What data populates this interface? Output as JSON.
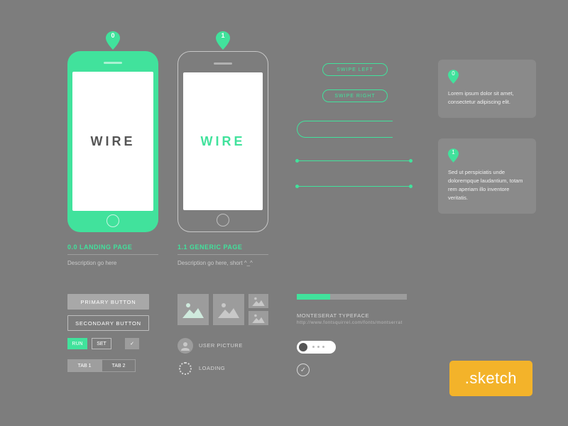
{
  "pins": {
    "p0": "0",
    "p1": "1"
  },
  "phones": {
    "green": {
      "title": "WIRE",
      "label": "0.0 LANDING PAGE",
      "desc": "Description go here"
    },
    "gray": {
      "title": "WIRE",
      "label": "1.1 GENERIC PAGE",
      "desc": "Description go here, short ^_^"
    }
  },
  "gestures": {
    "swipe_left": "SWIPE LEFT",
    "swipe_right": "SWIPE RIGHT"
  },
  "annotations": {
    "a0": {
      "num": "0",
      "text": "Lorem ipsum dolor sit amet, consectetur adipiscing elit."
    },
    "a1": {
      "num": "1",
      "text": "Sed ut perspiciatis unde dolorempque laudantium, totam rem aperiam illo inventore veritatis."
    }
  },
  "buttons": {
    "primary": "PRIMARY BUTTON",
    "secondary": "SECONDARY BUTTON",
    "run": "RUN",
    "set": "SET",
    "tab1": "TAB 1",
    "tab2": "TAB 2"
  },
  "labels": {
    "user_picture": "USER PICTURE",
    "loading": "LOADING",
    "typeface": "MONTESERAT TYPEFACE",
    "typeface_url": "http://www.fontsquirrel.com/fonts/montserrat"
  },
  "badge": ".sketch",
  "colors": {
    "accent": "#41e29c",
    "bg": "#7d7d7d",
    "badge": "#f3b32a"
  }
}
